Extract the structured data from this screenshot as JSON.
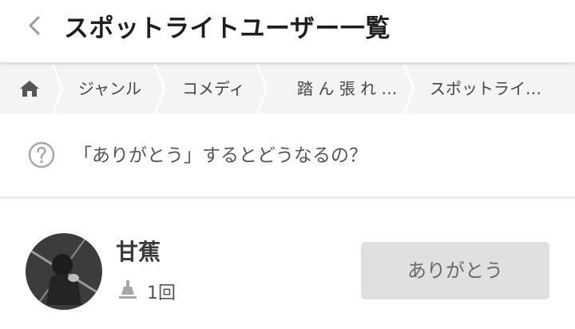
{
  "header": {
    "title": "スポットライトユーザー一覧",
    "back_icon": "chevron-left-icon"
  },
  "breadcrumb": {
    "home_icon": "home-icon",
    "items": [
      {
        "label": "ジャンル"
      },
      {
        "label": "コメディ"
      },
      {
        "label": "踏 ん 張 れ …"
      },
      {
        "label": "スポットライ…"
      }
    ]
  },
  "help": {
    "icon": "question-circle-icon",
    "text": "「ありがとう」するとどうなるの？"
  },
  "users": [
    {
      "name": "甘蕉",
      "spotlight_icon": "spotlight-icon",
      "spotlight_count": "1回",
      "thanks_label": "ありがとう"
    }
  ],
  "colors": {
    "breadcrumb_bg": "#f4f4f4",
    "button_bg": "#e0e0e0",
    "icon_gray": "#9a9a9a"
  }
}
